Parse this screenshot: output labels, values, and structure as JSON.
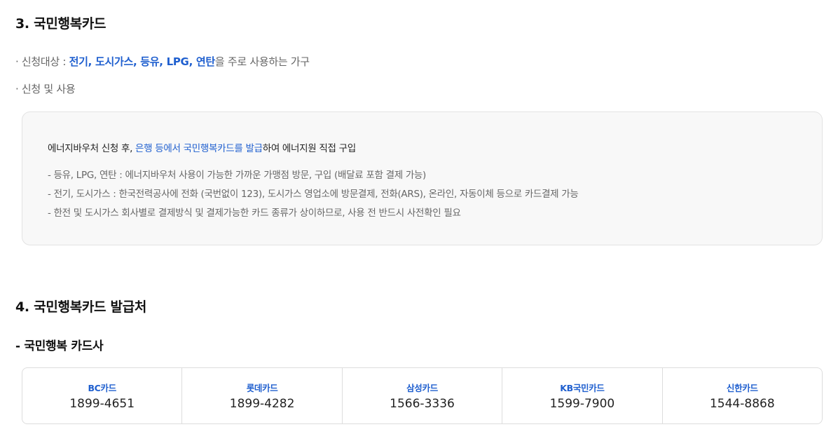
{
  "section3": {
    "title": "3. 국민행복카드",
    "target": {
      "prefix": "· 신청대상 : ",
      "highlight": "전기, 도시가스, 등유, LPG, 연탄",
      "suffix": "을 주로 사용하는 가구"
    },
    "usage_label": "· 신청 및 사용",
    "info_box": {
      "lead_prefix": "에너지바우처 신청 후, ",
      "lead_highlight": "은행 등에서 국민행복카드를 발급",
      "lead_suffix": "하여 에너지원 직접 구입",
      "lines": [
        "- 등유, LPG, 연탄 : 에너지바우처 사용이 가능한 가까운 가맹점 방문, 구입 (배달료 포함 결제 가능)",
        "- 전기, 도시가스 : 한국전력공사에 전화 (국번없이 123), 도시가스 영업소에 방문결제, 전화(ARS), 온라인, 자동이체 등으로 카드결제 가능",
        "- 한전 및 도시가스 회사별로 결제방식 및 결제가능한 카드 종류가 상이하므로, 사용 전 반드시 사전확인 필요"
      ]
    }
  },
  "section4": {
    "title": "4. 국민행복카드 발급처",
    "subtitle": "- 국민행복 카드사",
    "cards": [
      {
        "name": "BC카드",
        "phone": "1899-4651"
      },
      {
        "name": "롯데카드",
        "phone": "1899-4282"
      },
      {
        "name": "삼성카드",
        "phone": "1566-3336"
      },
      {
        "name": "KB국민카드",
        "phone": "1599-7900"
      },
      {
        "name": "신한카드",
        "phone": "1544-8868"
      }
    ]
  },
  "colors": {
    "accent": "#1f5fcf",
    "muted_text": "#666666",
    "box_bg": "#f8f8f8"
  }
}
